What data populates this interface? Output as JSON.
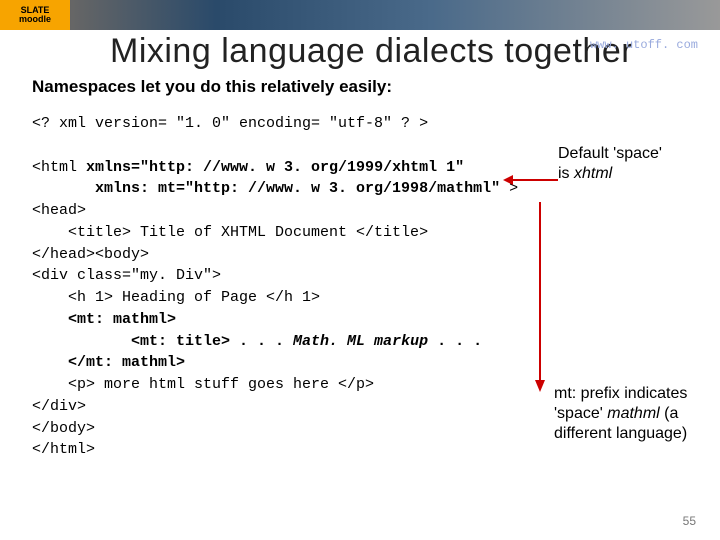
{
  "banner": {
    "brand_top": "SLATE",
    "brand_bottom": "moodle"
  },
  "url": "www. utoff. com",
  "title": "Mixing language dialects together",
  "subtitle": "Namespaces let you do this relatively easily:",
  "code": {
    "l1": "<? xml version= \"1. 0\" encoding= \"utf-8\" ? >",
    "l2a": "<html ",
    "l2b": "xmlns=\"http: //www. w 3. org/1999/xhtml 1\"",
    "l3a": "       xmlns: mt=\"http: //www. w 3. org/1998/mathml\"",
    "l3b": " >",
    "l4": "<head>",
    "l5": "    <title> Title of XHTML Document </title>",
    "l6": "</head><body>",
    "l7": "<div class=\"my. Div\">",
    "l8": "    <h 1> Heading of Page </h 1>",
    "l9": "    <mt: mathml>",
    "l10a": "           <mt: title> . . . ",
    "l10b": "Math. ML markup",
    "l10c": " . . .",
    "l11": "    </mt: mathml>",
    "l12": "    <p> more html stuff goes here </p>",
    "l13": "</div>",
    "l14": "</body>",
    "l15": "</html>"
  },
  "note1": {
    "line1": "Default 'space'",
    "line2_a": "is ",
    "line2_b": "xhtml"
  },
  "note2": {
    "line1_a": "mt: ",
    "line1_b": "prefix indicates",
    "line2_a": "'space' ",
    "line2_b": "mathml",
    "line2_c": " (a",
    "line3": "different language)"
  },
  "page_number": "55"
}
